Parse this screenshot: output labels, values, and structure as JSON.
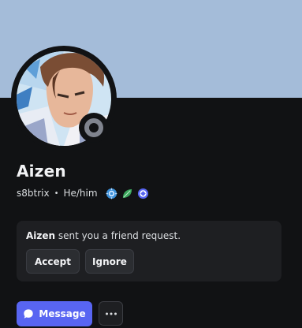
{
  "colors": {
    "banner": "#a4bcd9",
    "background": "#111214",
    "card": "#1e1f22",
    "button": "#2b2d31",
    "accent": "#5865f2",
    "status_offline": "#80848e"
  },
  "profile": {
    "display_name": "Aizen",
    "username": "s8btrix",
    "separator": "•",
    "pronouns": "He/him",
    "status": "offline",
    "badges": [
      "hypesquad-balance-icon",
      "leaf-icon",
      "quest-badge-icon"
    ]
  },
  "friend_request": {
    "name": "Aizen",
    "message": "sent you a friend request.",
    "accept_label": "Accept",
    "ignore_label": "Ignore"
  },
  "actions": {
    "message_label": "Message",
    "more_icon": "more-horizontal-icon"
  }
}
